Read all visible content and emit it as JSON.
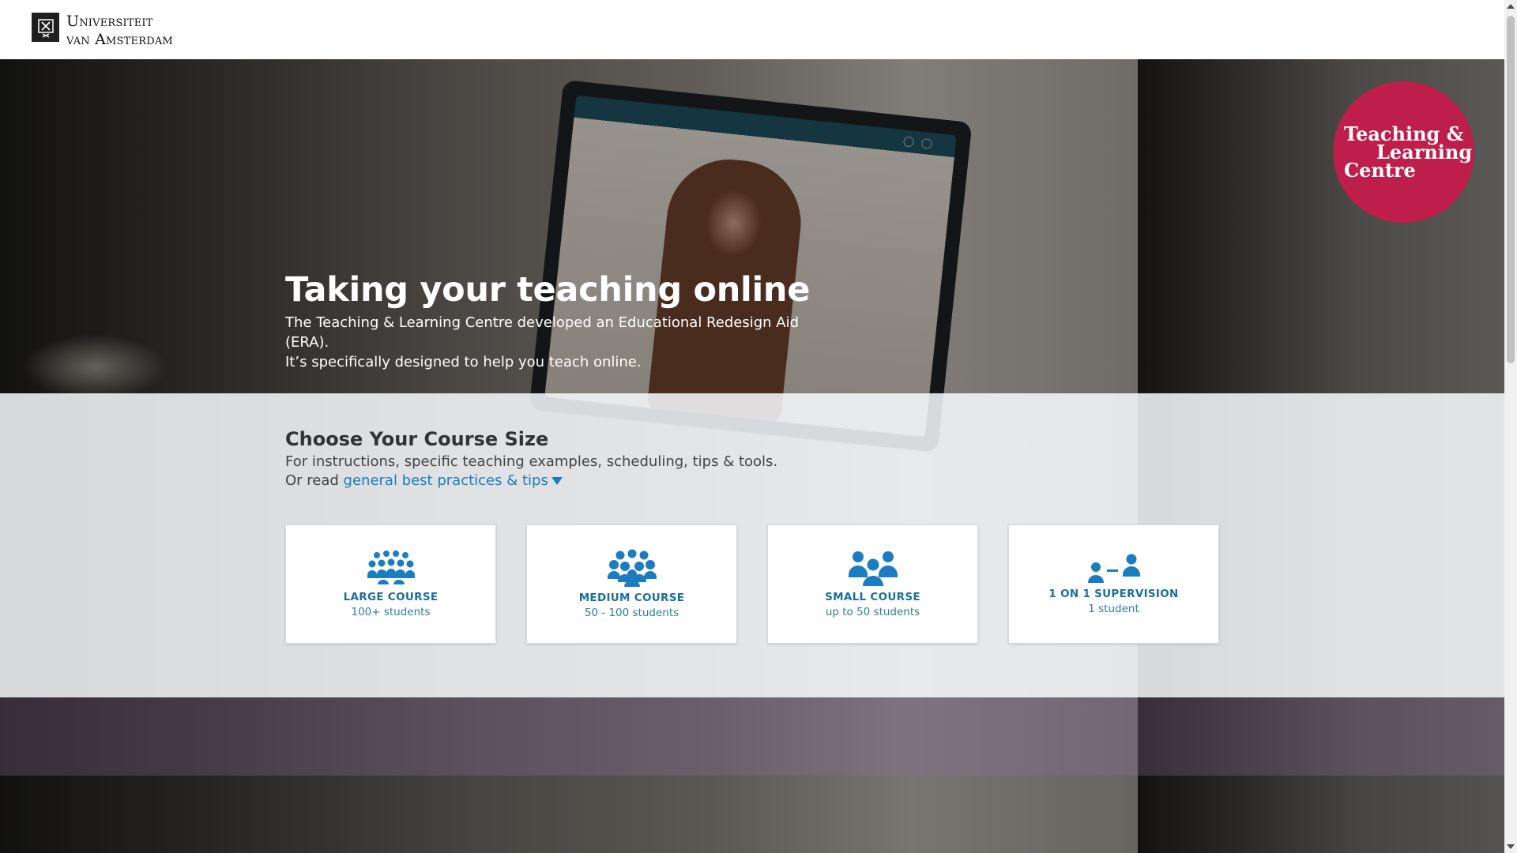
{
  "header": {
    "logo_line1": "Universiteit",
    "logo_line2": "van Amsterdam",
    "logo_icon": "uva-shield-icon"
  },
  "hero": {
    "title": "Taking your teaching online",
    "subtitle_line1": "The Teaching & Learning Centre developed an Educational Redesign Aid (ERA).",
    "subtitle_line2": "It’s specifically designed to help you teach online."
  },
  "badge": {
    "line1": "Teaching &",
    "line2": "Learning",
    "line3": "Centre",
    "color": "#be1e4a"
  },
  "course_section": {
    "title": "Choose Your Course Size",
    "line1": "For instructions, specific teaching examples, scheduling, tips & tools.",
    "line2_prefix": "Or read ",
    "link_text": "general best practices & tips",
    "link_color": "#1c7cc2",
    "cards": [
      {
        "icon": "large-group-icon",
        "title": "LARGE COURSE",
        "subtitle": "100+ students"
      },
      {
        "icon": "medium-group-icon",
        "title": "MEDIUM COURSE",
        "subtitle": "50 - 100 students"
      },
      {
        "icon": "small-group-icon",
        "title": "SMALL COURSE",
        "subtitle": "up to 50 students"
      },
      {
        "icon": "one-on-one-icon",
        "title": "1 ON 1 SUPERVISION",
        "subtitle": "1 student"
      }
    ],
    "icon_color": "#1c7cc2"
  }
}
